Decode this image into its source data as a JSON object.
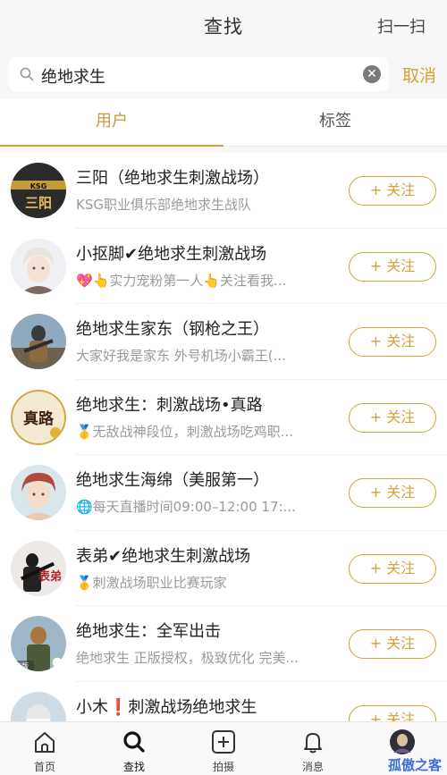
{
  "header": {
    "title": "查找",
    "scan_label": "扫一扫"
  },
  "search": {
    "value": "绝地求生",
    "cancel_label": "取消"
  },
  "tabs": [
    {
      "label": "用户",
      "active": true
    },
    {
      "label": "标签",
      "active": false
    }
  ],
  "results": [
    {
      "name": "三阳（绝地求生刺激战场）",
      "desc": "KSG职业俱乐部绝地求生战队",
      "follow": "+ 关注",
      "avatar_icon": "ksg-logo-avatar",
      "avatar_text": "三阳"
    },
    {
      "name": "小抠脚✔绝地求生刺激战场",
      "desc": "💖👆实力宠粉第一人👆关注看我...",
      "follow": "+ 关注",
      "avatar_icon": "anime-boy-avatar"
    },
    {
      "name": "绝地求生家东（钢枪之王）",
      "desc": "大家好我是家东   外号机场小霸王(...",
      "follow": "+ 关注",
      "avatar_icon": "soldier-avatar"
    },
    {
      "name": "绝地求生：刺激战场•真路",
      "desc": "🥇无敌战神段位，刺激战场吃鸡职...",
      "follow": "+ 关注",
      "avatar_icon": "calligraphy-avatar",
      "avatar_text": "真路"
    },
    {
      "name": "绝地求生海绵（美服第一）",
      "desc": "🌐每天直播时间09:00–12:00   17:...",
      "follow": "+ 关注",
      "avatar_icon": "anime-redhair-avatar"
    },
    {
      "name": "表弟✔绝地求生刺激战场",
      "desc": "🥇刺激战场职业比赛玩家",
      "follow": "+ 关注",
      "avatar_icon": "gunner-avatar",
      "avatar_text": "表弟"
    },
    {
      "name": "绝地求生：全军出击",
      "desc": "绝地求生 正版授权，极致优化 完美...",
      "follow": "+ 关注",
      "avatar_icon": "game-avatar",
      "avatar_text": "正版"
    },
    {
      "name": "小木❗刺激战场绝地求生",
      "desc": "",
      "follow": "+ 关注",
      "avatar_icon": "masked-avatar"
    }
  ],
  "nav": [
    {
      "label": "首页",
      "icon": "home-icon"
    },
    {
      "label": "查找",
      "icon": "search-icon"
    },
    {
      "label": "拍摄",
      "icon": "plus-square-icon"
    },
    {
      "label": "消息",
      "icon": "bell-icon"
    },
    {
      "label": "",
      "icon": "profile-avatar-icon"
    }
  ],
  "watermark": "孤傲之客",
  "colors": {
    "accent": "#d4a23a",
    "background": "#f7f7f7"
  }
}
